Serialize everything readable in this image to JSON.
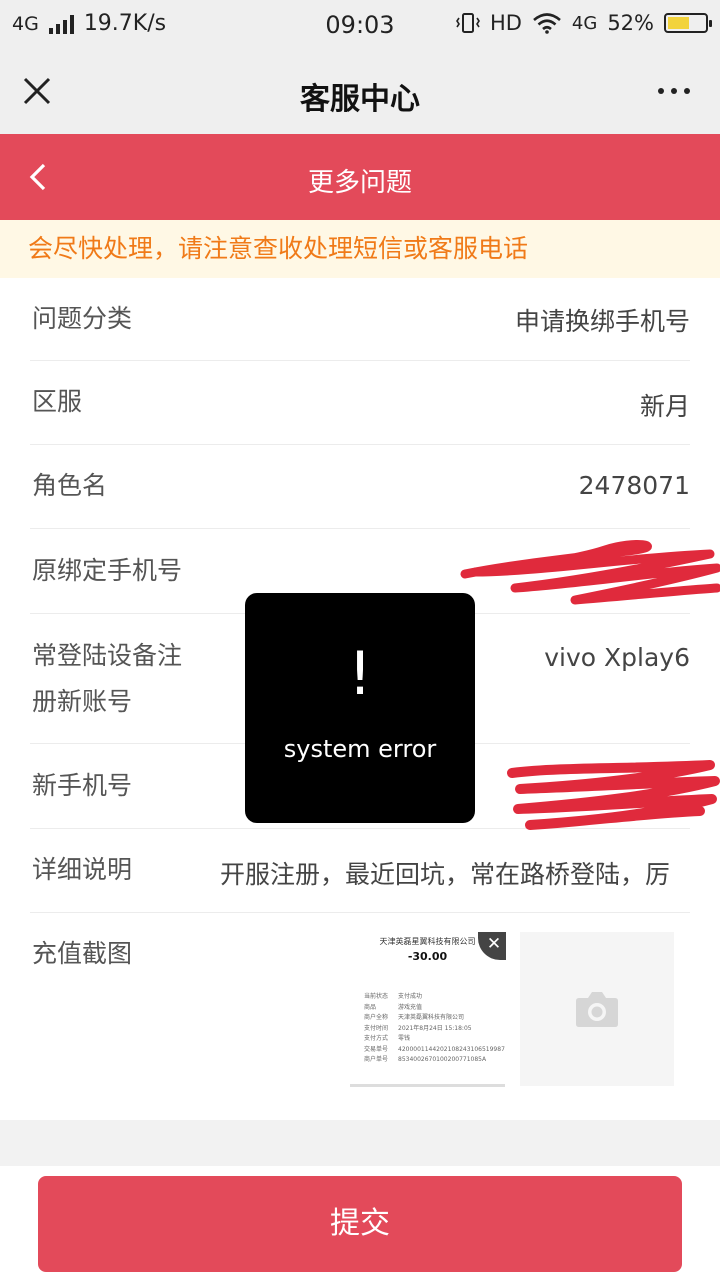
{
  "status_bar": {
    "network": "4G",
    "speed": "19.7K/s",
    "time": "09:03",
    "hd": "HD",
    "mobile_data": "4G",
    "battery": "52%"
  },
  "titlebar": {
    "title": "客服中心"
  },
  "header": {
    "title": "更多问题"
  },
  "notice": "会尽快处理，请注意查收处理短信或客服电话",
  "form": {
    "category": {
      "label": "问题分类",
      "value": "申请换绑手机号"
    },
    "server": {
      "label": "区服",
      "value": "新月"
    },
    "role": {
      "label": "角色名",
      "value": "2478071"
    },
    "old_phone": {
      "label": "原绑定手机号"
    },
    "device": {
      "label_line1": "常登陆设备注",
      "label_line2": "册新账号",
      "value": "vivo Xplay6"
    },
    "new_phone": {
      "label": "新手机号"
    },
    "detail": {
      "label": "详细说明",
      "value": "开服注册，最近回坑，常在路桥登陆，厉"
    },
    "screenshot": {
      "label": "充值截图",
      "thumb_company": "天津英磊星翼科技有限公司",
      "thumb_amount": "-30.00",
      "thumb_rows": [
        {
          "k": "当前状态",
          "v": "支付成功"
        },
        {
          "k": "商品",
          "v": "游戏充值"
        },
        {
          "k": "商户全称",
          "v": "天津英磊翼科技有限公司"
        },
        {
          "k": "支付时间",
          "v": "2021年8月24日 15:18:05"
        },
        {
          "k": "支付方式",
          "v": "零钱"
        },
        {
          "k": "交易单号",
          "v": "4200001144202108243106519987"
        },
        {
          "k": "商户单号",
          "v": "8534002670100200771085A"
        }
      ]
    }
  },
  "toast": {
    "text": "system error"
  },
  "submit_label": "提交"
}
